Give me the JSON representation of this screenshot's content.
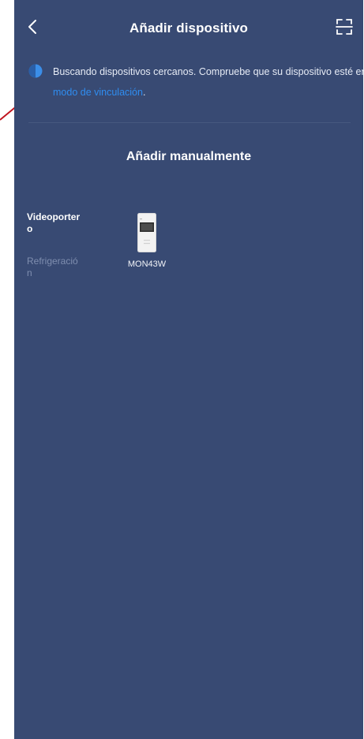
{
  "header": {
    "title": "Añadir dispositivo",
    "back_icon": "chevron-left-icon",
    "scan_icon": "scan-icon"
  },
  "notice": {
    "text_before": "Buscando dispositivos cercanos. Compruebe que su dispositivo esté en ",
    "link_text": "modo de vinculación",
    "text_after": "."
  },
  "section": {
    "title": "Añadir manualmente"
  },
  "categories": [
    {
      "label": "Videoportero",
      "active": true
    },
    {
      "label": "Refrigeración",
      "active": false
    }
  ],
  "devices": [
    {
      "name": "MON43W",
      "icon": "video-intercom-monitor-icon"
    }
  ],
  "colors": {
    "background": "#384a73",
    "link": "#2f8df0",
    "inactive_text": "#7f8eaf",
    "annotation_arrow": "#c0141e"
  }
}
